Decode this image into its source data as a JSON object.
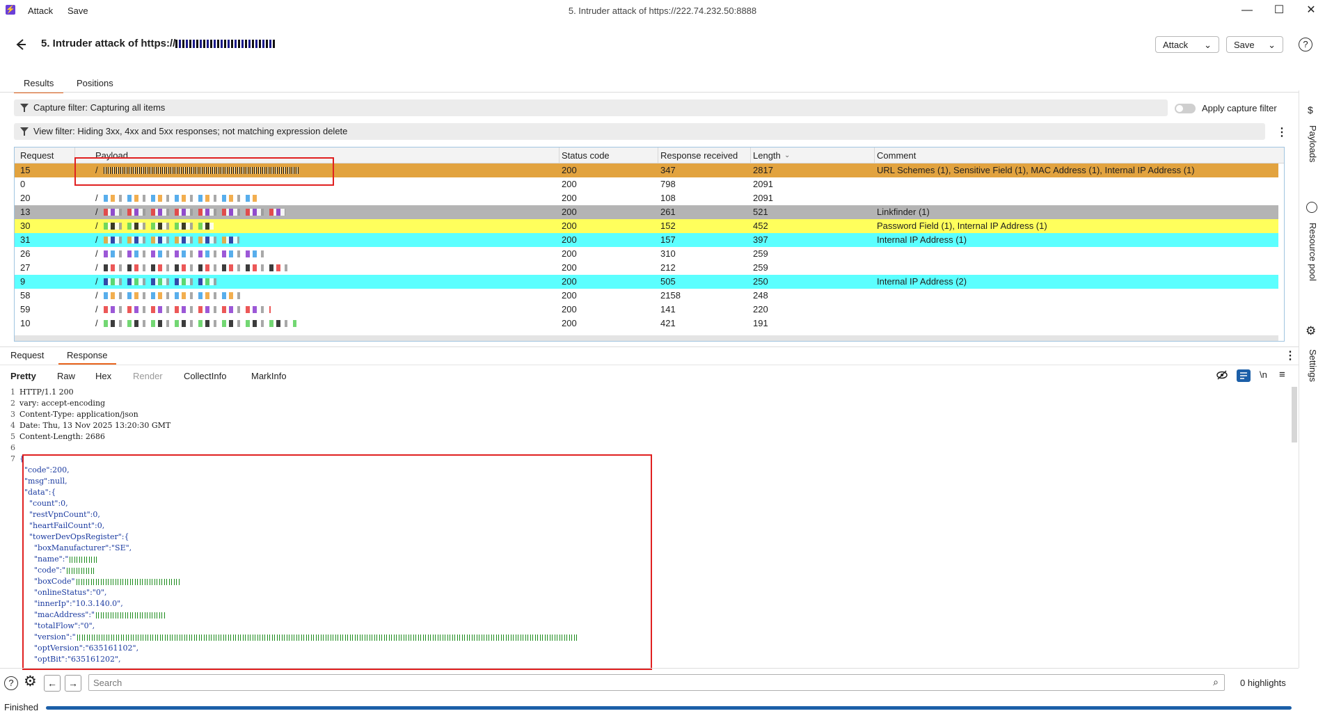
{
  "titlebar": {
    "menu_attack": "Attack",
    "menu_save": "Save",
    "window_title": "5. Intruder attack of https://222.74.232.50:8888",
    "minimize": "—",
    "maximize": "☐",
    "close": "✕"
  },
  "header": {
    "title": "5. Intruder attack of https://",
    "attack_button": "Attack",
    "save_button": "Save",
    "help_icon": "?"
  },
  "tabs": {
    "results": "Results",
    "positions": "Positions"
  },
  "filters": {
    "capture_filter": "Capture filter: Capturing all items",
    "apply_capture_filter": "Apply capture filter",
    "view_filter": "View filter: Hiding 3xx, 4xx and 5xx responses; not matching expression delete"
  },
  "table": {
    "columns": [
      "Request",
      "Payload",
      "Status code",
      "Response received",
      "Length",
      "Comment"
    ],
    "rows": [
      {
        "request": "15",
        "payload": "/",
        "status": "200",
        "received": "347",
        "length": "2817",
        "comment": "URL Schemes (1), Sensitive Field (1), MAC Address (1), Internal IP Address (1)",
        "highlight": "#e2a33f"
      },
      {
        "request": "0",
        "payload": "",
        "status": "200",
        "received": "798",
        "length": "2091",
        "comment": "",
        "highlight": "#ffffff"
      },
      {
        "request": "20",
        "payload": "/",
        "status": "200",
        "received": "108",
        "length": "2091",
        "comment": "",
        "highlight": "#ffffff"
      },
      {
        "request": "13",
        "payload": "/",
        "status": "200",
        "received": "261",
        "length": "521",
        "comment": "Linkfinder (1)",
        "highlight": "#b4b4b4"
      },
      {
        "request": "30",
        "payload": "/",
        "status": "200",
        "received": "152",
        "length": "452",
        "comment": "Password Field (1), Internal IP Address (1)",
        "highlight": "#ffff5c"
      },
      {
        "request": "31",
        "payload": "/",
        "status": "200",
        "received": "157",
        "length": "397",
        "comment": "Internal IP Address (1)",
        "highlight": "#5cffff"
      },
      {
        "request": "26",
        "payload": "/",
        "status": "200",
        "received": "310",
        "length": "259",
        "comment": "",
        "highlight": "#ffffff"
      },
      {
        "request": "27",
        "payload": "/",
        "status": "200",
        "received": "212",
        "length": "259",
        "comment": "",
        "highlight": "#ffffff"
      },
      {
        "request": "9",
        "payload": "/",
        "status": "200",
        "received": "505",
        "length": "250",
        "comment": "Internal IP Address (2)",
        "highlight": "#5cffff"
      },
      {
        "request": "58",
        "payload": "/",
        "status": "200",
        "received": "2158",
        "length": "248",
        "comment": "",
        "highlight": "#ffffff"
      },
      {
        "request": "59",
        "payload": "/",
        "status": "200",
        "received": "141",
        "length": "220",
        "comment": "",
        "highlight": "#ffffff"
      },
      {
        "request": "10",
        "payload": "/",
        "status": "200",
        "received": "421",
        "length": "191",
        "comment": "",
        "highlight": "#ffffff"
      }
    ]
  },
  "lower": {
    "tab_request": "Request",
    "tab_response": "Response",
    "view_tabs": [
      "Pretty",
      "Raw",
      "Hex",
      "Render",
      "CollectInfo",
      "MarkInfo"
    ],
    "newline_toggle": "\\n"
  },
  "response_lines": [
    {
      "n": "1",
      "text": "HTTP/1.1 200"
    },
    {
      "n": "2",
      "text": "vary: accept-encoding"
    },
    {
      "n": "3",
      "text": "Content-Type: application/json"
    },
    {
      "n": "4",
      "text": "Date: Thu, 13 Nov 2025 13:20:30 GMT"
    },
    {
      "n": "5",
      "text": "Content-Length: 2686"
    },
    {
      "n": "6",
      "text": ""
    },
    {
      "n": "7",
      "text": "{"
    },
    {
      "n": "",
      "text": "  \"code\":200,"
    },
    {
      "n": "",
      "text": "  \"msg\":null,"
    },
    {
      "n": "",
      "text": "  \"data\":{"
    },
    {
      "n": "",
      "text": "    \"count\":0,"
    },
    {
      "n": "",
      "text": "    \"restVpnCount\":0,"
    },
    {
      "n": "",
      "text": "    \"heartFailCount\":0,"
    },
    {
      "n": "",
      "text": "    \"towerDevOpsRegister\":{"
    },
    {
      "n": "",
      "text": "      \"boxManufacturer\":\"SE\","
    },
    {
      "n": "",
      "text": "      \"name\":\"",
      "redacted": true
    },
    {
      "n": "",
      "text": "      \"code\":\"",
      "redacted": true
    },
    {
      "n": "",
      "text": "      \"boxCode\"",
      "redacted": true
    },
    {
      "n": "",
      "text": "      \"onlineStatus\":\"0\","
    },
    {
      "n": "",
      "text": "      \"innerIp\":\"10.3.140.0\","
    },
    {
      "n": "",
      "text": "      \"macAddress\":\"",
      "redacted": true
    },
    {
      "n": "",
      "text": "      \"totalFlow\":\"0\","
    },
    {
      "n": "",
      "text": "      \"version\":\"",
      "redacted": true
    },
    {
      "n": "",
      "text": "      \"optVersion\":\"635161102\","
    },
    {
      "n": "",
      "text": "      \"optBit\":\"635161202\","
    }
  ],
  "sidebar": {
    "payloads": "Payloads",
    "resource_pool": "Resource pool",
    "settings": "Settings"
  },
  "bottom": {
    "search_placeholder": "Search",
    "highlights": "0 highlights",
    "status": "Finished"
  },
  "colors": {
    "accent": "#e8631c",
    "progress": "#1c5fa8",
    "annotation": "#e02020"
  },
  "progress_fraction": 1.0,
  "icons": [
    "back-arrow-icon",
    "help-icon",
    "funnel-icon",
    "toggle-icon",
    "more-vertical-icon",
    "eye-off-icon",
    "wrap-icon",
    "menu-icon",
    "payloads-icon",
    "resource-pool-icon",
    "settings-icon",
    "search-icon",
    "arrow-left-icon",
    "arrow-right-icon"
  ]
}
